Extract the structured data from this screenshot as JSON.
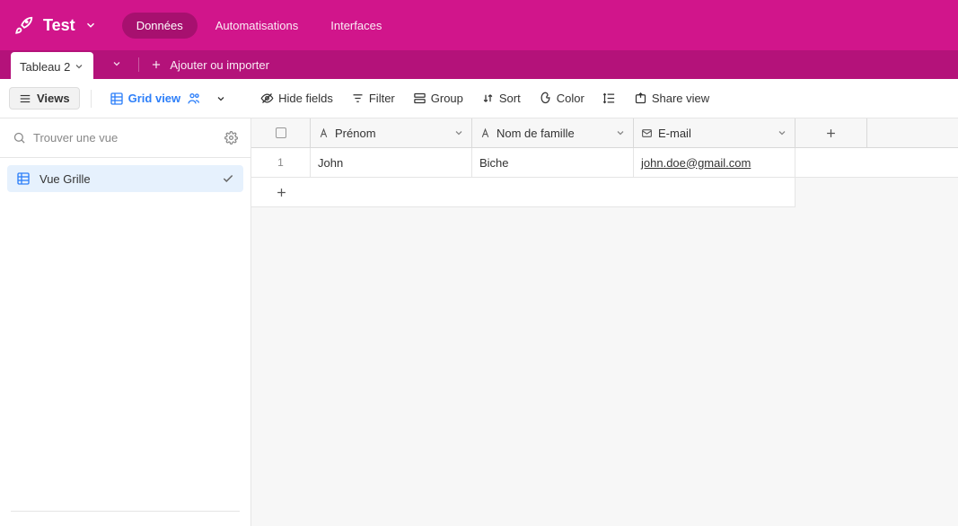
{
  "header": {
    "baseName": "Test",
    "navTabs": [
      {
        "label": "Données",
        "active": true
      },
      {
        "label": "Automatisations",
        "active": false
      },
      {
        "label": "Interfaces",
        "active": false
      }
    ]
  },
  "tabsBar": {
    "tableName": "Tableau 2",
    "addImport": "Ajouter ou importer"
  },
  "toolbar": {
    "views": "Views",
    "gridView": "Grid view",
    "hideFields": "Hide fields",
    "filter": "Filter",
    "group": "Group",
    "sort": "Sort",
    "color": "Color",
    "shareView": "Share view"
  },
  "sidebar": {
    "searchPlaceholder": "Trouver une vue",
    "views": [
      {
        "name": "Vue Grille",
        "active": true
      }
    ]
  },
  "grid": {
    "columns": [
      {
        "label": "Prénom",
        "type": "text"
      },
      {
        "label": "Nom de famille",
        "type": "text"
      },
      {
        "label": "E-mail",
        "type": "email"
      }
    ],
    "rows": [
      {
        "num": "1",
        "cells": [
          "John",
          "Biche",
          "john.doe@gmail.com"
        ]
      }
    ]
  }
}
